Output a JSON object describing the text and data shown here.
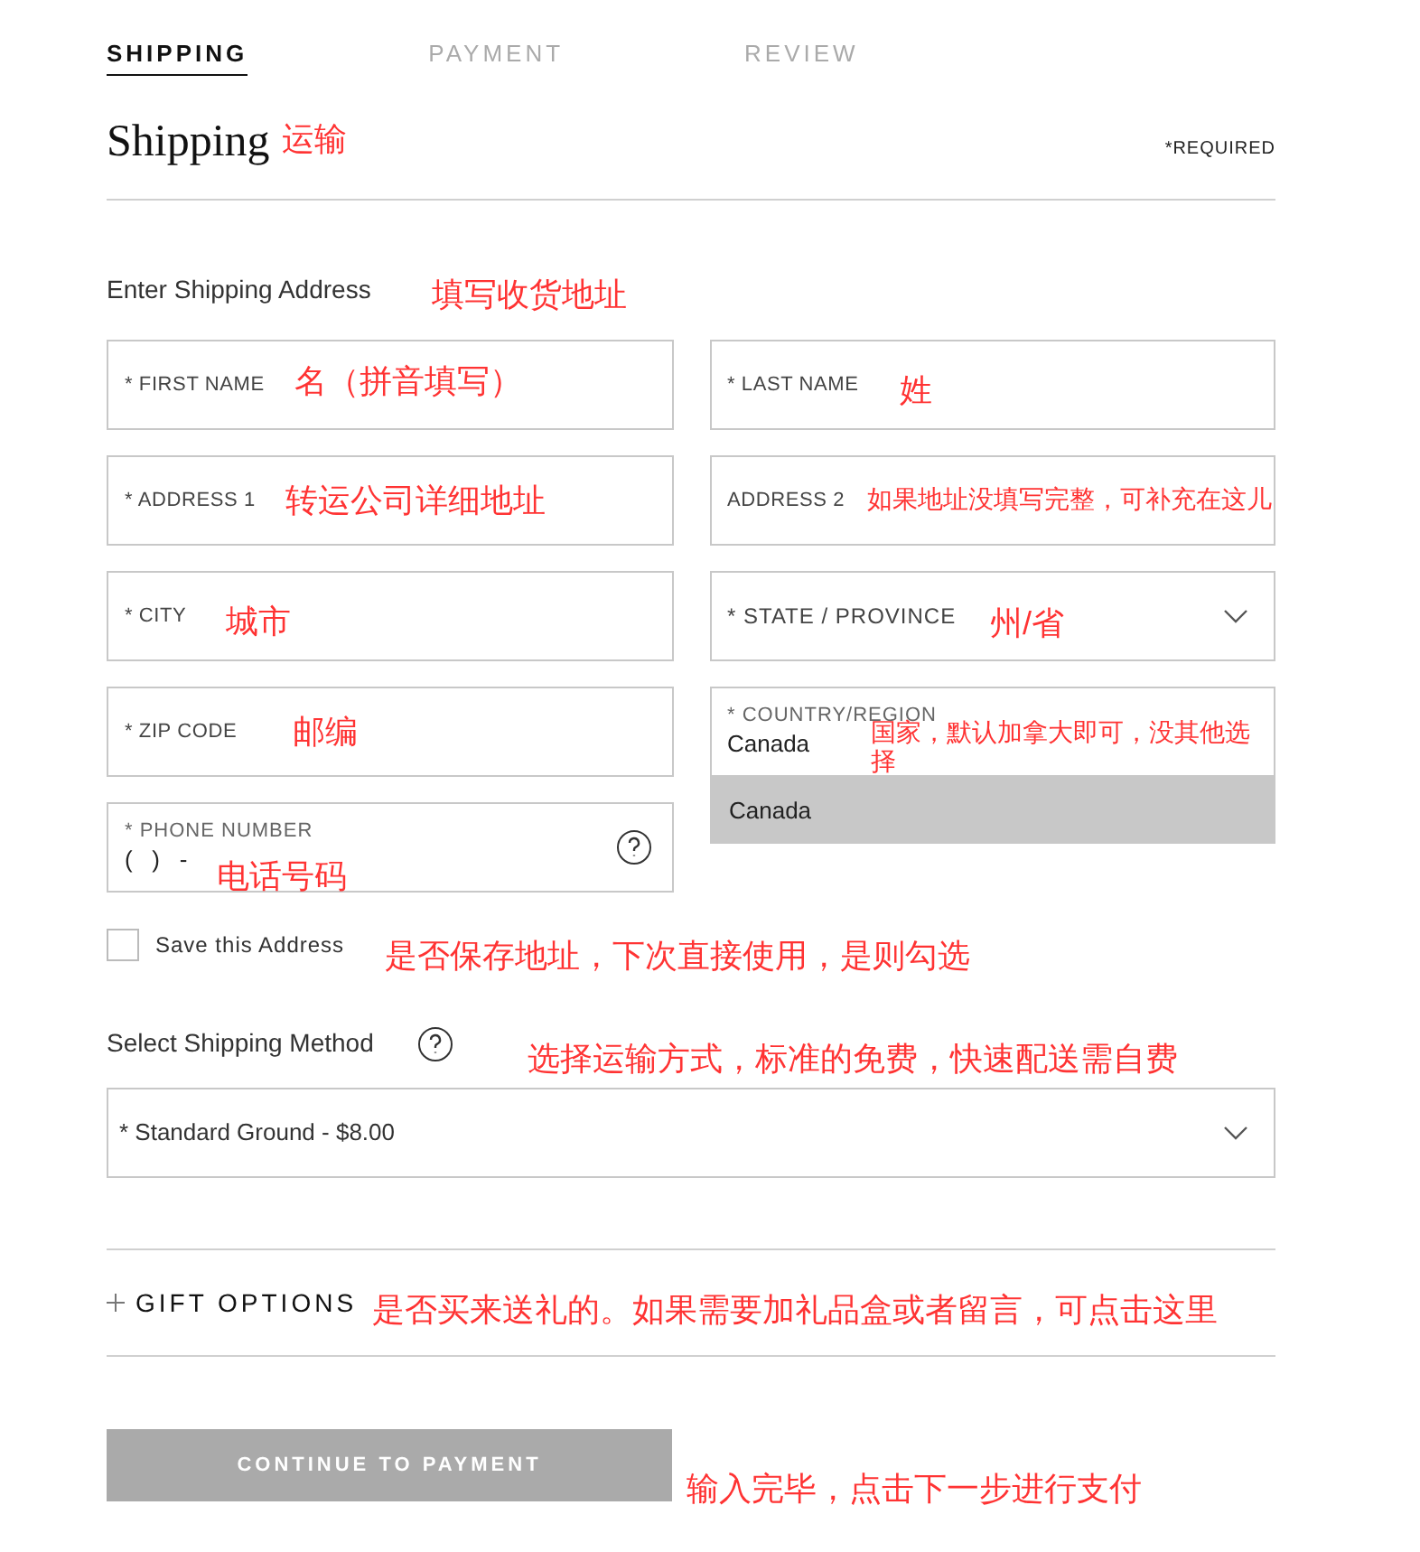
{
  "tabs": [
    {
      "label": "SHIPPING",
      "selected": true
    },
    {
      "label": "PAYMENT",
      "selected": false
    },
    {
      "label": "REVIEW",
      "selected": false
    }
  ],
  "heading": {
    "title": "Shipping",
    "annotation": "运输",
    "required": "*REQUIRED"
  },
  "address_section": {
    "label": "Enter Shipping Address",
    "annotation": "填写收货地址"
  },
  "fields": [
    {
      "kind": "text",
      "label": "* FIRST NAME",
      "annotation": "名（拼音填写）"
    },
    {
      "kind": "text",
      "label": "* LAST NAME",
      "annotation": "姓"
    },
    {
      "kind": "text",
      "label": "* ADDRESS 1",
      "annotation": "转运公司详细地址"
    },
    {
      "kind": "text",
      "label": "ADDRESS 2",
      "annotation": "如果地址没填写完整，可补充在这儿"
    },
    {
      "kind": "text",
      "label": "* CITY",
      "annotation": "城市"
    },
    {
      "kind": "select",
      "label": "* STATE / PROVINCE",
      "annotation": "州/省"
    },
    {
      "kind": "text",
      "label": "* ZIP CODE",
      "annotation": "邮编"
    },
    {
      "kind": "country",
      "label": "* COUNTRY/REGION",
      "value": "Canada",
      "option": "Canada",
      "annotation": "国家，默认加拿大即可，没其他选择"
    },
    {
      "kind": "phone",
      "label": "* PHONE NUMBER",
      "value": "(   )   -",
      "annotation": "电话号码"
    }
  ],
  "save_address": {
    "label": "Save this Address",
    "checked": false,
    "annotation": "是否保存地址，下次直接使用，是则勾选"
  },
  "shipping_method": {
    "label": "Select Shipping Method",
    "annotation": "选择运输方式，标准的免费，快速配送需自费",
    "value": "* Standard Ground - $8.00"
  },
  "gift_options": {
    "label": "GIFT OPTIONS",
    "annotation": "是否买来送礼的。如果需要加礼品盒或者留言，可点击这里"
  },
  "continue_button": {
    "label": "CONTINUE TO PAYMENT",
    "annotation": "输入完毕，点击下一步进行支付"
  }
}
